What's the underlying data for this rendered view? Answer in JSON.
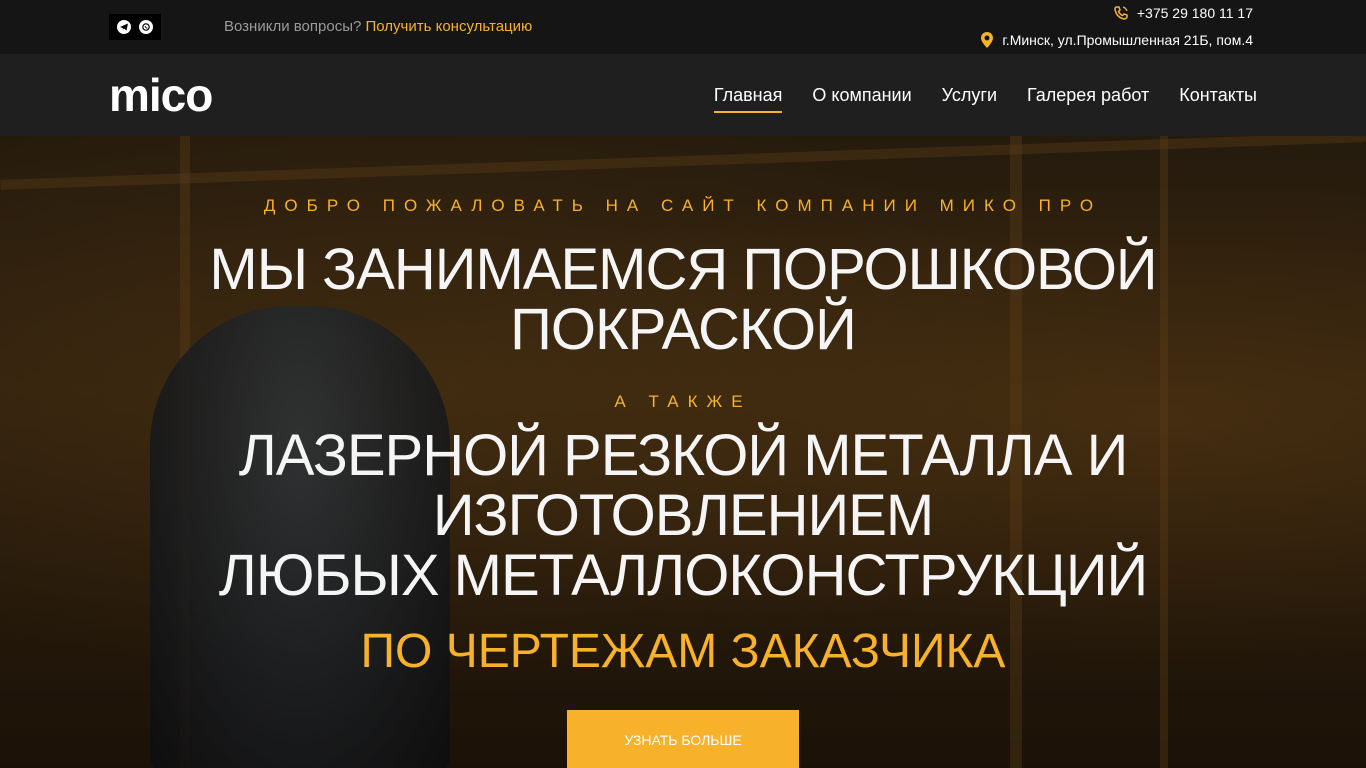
{
  "topbar": {
    "question_text": "Возникли вопросы?",
    "consult_link": "Получить консультацию",
    "phone": "+375 29 180 11 17",
    "address": "г.Минск, ул.Промышленная 21Б, пом.4"
  },
  "header": {
    "logo": "mico",
    "nav": [
      {
        "label": "Главная"
      },
      {
        "label": "О компании"
      },
      {
        "label": "Услуги"
      },
      {
        "label": "Галерея работ"
      },
      {
        "label": "Контакты"
      }
    ]
  },
  "hero": {
    "subtitle": "ДОБРО ПОЖАЛОВАТЬ НА САЙТ КОМПАНИИ МИКО ПРО",
    "headline_1_line_1": "МЫ ЗАНИМАЕМСЯ ПОРОШКОВОЙ",
    "headline_1_line_2": "ПОКРАСКОЙ",
    "also": "А ТАКЖЕ",
    "headline_2_line_1": "ЛАЗЕРНОЙ РЕЗКОЙ МЕТАЛЛА И",
    "headline_2_line_2": "ИЗГОТОВЛЕНИЕМ",
    "headline_2_line_3": "ЛЮБЫХ МЕТАЛЛОКОНСТРУКЦИЙ",
    "headline_3": "ПО ЧЕРТЕЖАМ ЗАКАЗЧИКА",
    "cta_label": "УЗНАТЬ БОЛЬШЕ"
  },
  "colors": {
    "accent": "#f7b12a",
    "topbar_bg": "#151515",
    "header_bg": "#1f1f1f"
  },
  "icons": [
    "telegram-icon",
    "viber-icon",
    "phone-icon",
    "location-pin-icon"
  ]
}
